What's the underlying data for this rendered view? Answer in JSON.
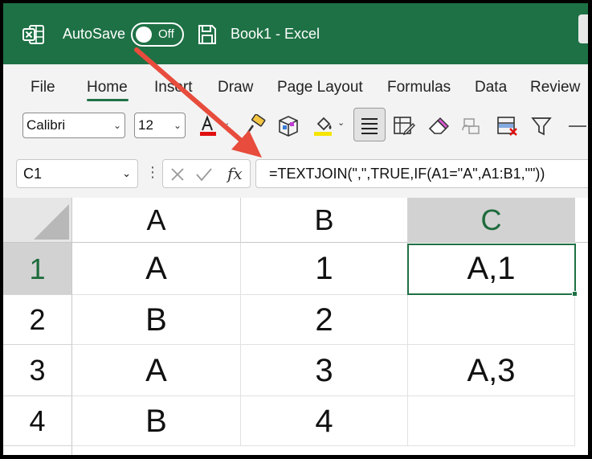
{
  "titlebar": {
    "autosave_label": "AutoSave",
    "autosave_state": "Off",
    "document_title": "Book1  -  Excel",
    "background_color": "#1e7145"
  },
  "menu": {
    "tabs": [
      "File",
      "Home",
      "Insert",
      "Draw",
      "Page Layout",
      "Formulas",
      "Data",
      "Review"
    ],
    "active_tab": "Home"
  },
  "ribbon": {
    "font_name": "Calibri",
    "font_size": "12",
    "icons": [
      "font-color-icon",
      "format-painter-icon",
      "cell-styles-icon",
      "fill-color-icon",
      "align-center-icon",
      "conditional-format-icon",
      "clear-icon",
      "copy-format-icon",
      "delete-icon",
      "filter-icon",
      "more-icon"
    ]
  },
  "formula_bar": {
    "name_box": "C1",
    "fx_label": "fx",
    "formula": "=TEXTJOIN(\",\",TRUE,IF(A1=\"A\",A1:B1,\"\"))"
  },
  "sheet": {
    "columns": [
      "A",
      "B",
      "C"
    ],
    "selected_column": "C",
    "rows": [
      {
        "num": "1",
        "A": "A",
        "B": "1",
        "C": "A,1"
      },
      {
        "num": "2",
        "A": "B",
        "B": "2",
        "C": ""
      },
      {
        "num": "3",
        "A": "A",
        "B": "3",
        "C": "A,3"
      },
      {
        "num": "4",
        "A": "B",
        "B": "4",
        "C": ""
      }
    ],
    "selected_cell": "C1"
  },
  "annotation": {
    "arrow_color": "#e74c3c"
  }
}
